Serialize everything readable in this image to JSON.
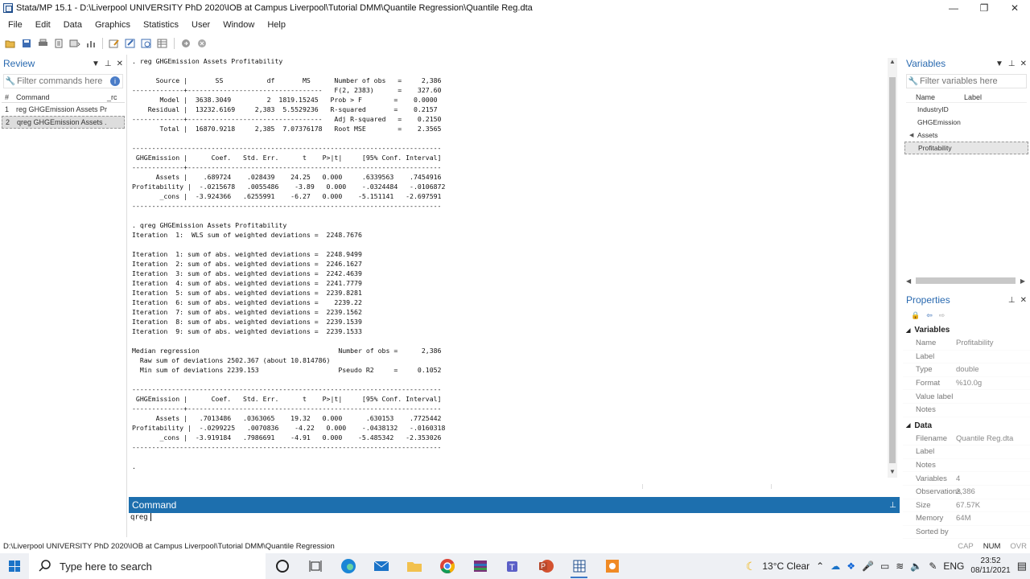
{
  "window": {
    "title": "Stata/MP 15.1 - D:\\Liverpool UNIVERSITY PhD 2020\\IOB at Campus Liverpool\\Tutorial DMM\\Quantile Regression\\Quantile Reg.dta",
    "minimize": "—",
    "maximize": "❐",
    "close": "✕"
  },
  "menu": [
    "File",
    "Edit",
    "Data",
    "Graphics",
    "Statistics",
    "User",
    "Window",
    "Help"
  ],
  "review": {
    "title": "Review",
    "filter_placeholder": "Filter commands here",
    "col_num": "#",
    "col_command": "Command",
    "col_rc": "_rc",
    "rows": [
      {
        "n": "1",
        "cmd": "reg GHGEmission Assets Pr...",
        "rc": ""
      },
      {
        "n": "2",
        "cmd": "qreg GHGEmission Assets ...",
        "rc": ""
      }
    ]
  },
  "results": {
    "text": ". reg GHGEmission Assets Profitability\n\n      Source |       SS           df       MS      Number of obs   =     2,386\n-------------+----------------------------------   F(2, 2383)      =    327.60\n       Model |  3638.3049         2  1819.15245   Prob > F        =    0.0000\n    Residual |  13232.6169     2,383  5.5529236   R-squared       =    0.2157\n-------------+----------------------------------   Adj R-squared   =    0.2150\n       Total |  16870.9218     2,385  7.07376178   Root MSE        =    2.3565\n\n------------------------------------------------------------------------------\n GHGEmission |      Coef.   Std. Err.      t    P>|t|     [95% Conf. Interval]\n-------------+----------------------------------------------------------------\n      Assets |    .689724    .028439    24.25   0.000     .6339563    .7454916\nProfitability |  -.0215678   .0055486    -3.89   0.000    -.0324484   -.0106872\n       _cons |  -3.924366   .6255991    -6.27   0.000    -5.151141   -2.697591\n------------------------------------------------------------------------------\n\n. qreg GHGEmission Assets Profitability\nIteration  1:  WLS sum of weighted deviations =  2248.7676\n\nIteration  1: sum of abs. weighted deviations =  2248.9499\nIteration  2: sum of abs. weighted deviations =  2246.1627\nIteration  3: sum of abs. weighted deviations =  2242.4639\nIteration  4: sum of abs. weighted deviations =  2241.7779\nIteration  5: sum of abs. weighted deviations =  2239.8281\nIteration  6: sum of abs. weighted deviations =    2239.22\nIteration  7: sum of abs. weighted deviations =  2239.1562\nIteration  8: sum of abs. weighted deviations =  2239.1539\nIteration  9: sum of abs. weighted deviations =  2239.1533\n\nMedian regression                                   Number of obs =      2,386\n  Raw sum of deviations 2502.367 (about 10.814786)\n  Min sum of deviations 2239.153                    Pseudo R2     =     0.1052\n\n------------------------------------------------------------------------------\n GHGEmission |      Coef.   Std. Err.      t    P>|t|     [95% Conf. Interval]\n-------------+----------------------------------------------------------------\n      Assets |   .7013486   .0363065    19.32   0.000      .630153    .7725442\nProfitability |  -.0299225   .0070836    -4.22   0.000    -.0438132   -.0160318\n       _cons |  -3.919184   .7986691    -4.91   0.000    -5.485342   -2.353026\n------------------------------------------------------------------------------\n\n."
  },
  "command": {
    "title": "Command",
    "value": "qreg"
  },
  "variables": {
    "title": "Variables",
    "filter_placeholder": "Filter variables here",
    "col_name": "Name",
    "col_label": "Label",
    "rows": [
      "IndustryID",
      "GHGEmission",
      "Assets",
      "Profitability"
    ]
  },
  "properties": {
    "title": "Properties",
    "variables_section": "Variables",
    "variables": [
      {
        "k": "Name",
        "v": "Profitability"
      },
      {
        "k": "Label",
        "v": ""
      },
      {
        "k": "Type",
        "v": "double"
      },
      {
        "k": "Format",
        "v": "%10.0g"
      },
      {
        "k": "Value label",
        "v": ""
      },
      {
        "k": "Notes",
        "v": ""
      }
    ],
    "data_section": "Data",
    "data": [
      {
        "k": "Filename",
        "v": "Quantile Reg.dta"
      },
      {
        "k": "Label",
        "v": ""
      },
      {
        "k": "Notes",
        "v": ""
      },
      {
        "k": "Variables",
        "v": "4"
      },
      {
        "k": "Observations",
        "v": "2,386"
      },
      {
        "k": "Size",
        "v": "67.57K"
      },
      {
        "k": "Memory",
        "v": "64M"
      },
      {
        "k": "Sorted by",
        "v": ""
      }
    ]
  },
  "status": {
    "path": "D:\\Liverpool UNIVERSITY PhD 2020\\IOB at Campus Liverpool\\Tutorial DMM\\Quantile Regression",
    "cap": "CAP",
    "num": "NUM",
    "ovr": "OVR"
  },
  "taskbar": {
    "search_placeholder": "Type here to search",
    "weather": "13°C  Clear",
    "lang": "ENG",
    "time": "23:52",
    "date": "08/11/2021"
  }
}
